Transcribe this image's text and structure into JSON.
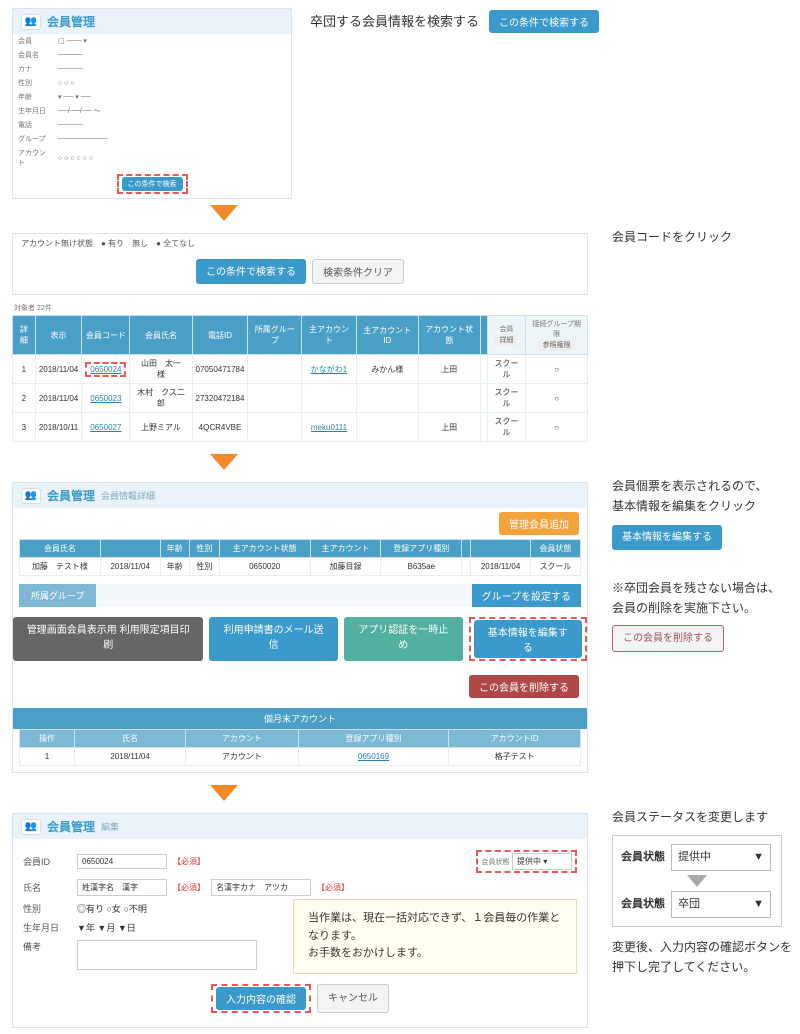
{
  "section1": {
    "caption": "卒団する会員情報を検索する",
    "searchBtn": "この条件で検索する",
    "searchFormTitle": "会員管理"
  },
  "section2": {
    "caption": "会員コードをクリック",
    "radioLabel": "アカウント無け状態",
    "radioAll": "● 有り",
    "radioNone": " 無し",
    "radioEither": "● 全てなし",
    "searchBtn": "この条件で検索する",
    "clearBtn": "検索条件クリア",
    "resultCount": "対象者 22件",
    "cols": [
      "詳細",
      "表示",
      "会員コード",
      "会員氏名",
      "電話ID",
      "所属グループ",
      "主アカウント",
      "主アカウントID",
      "アカウント状態",
      "",
      "会員",
      "接続グループ期限"
    ],
    "rows": [
      {
        "c": [
          "1",
          "2018/11/04",
          "0650024",
          "山田　太一　様",
          "07050471784",
          "",
          "かながわ1",
          "みかん様",
          "上田",
          "",
          "スクール",
          ""
        ]
      },
      {
        "c": [
          "2",
          "2018/11/04",
          "0650023",
          "木村　クス二郎",
          "27320472184",
          "",
          "",
          "",
          "",
          "",
          "スクール",
          ""
        ]
      },
      {
        "c": [
          "3",
          "2018/10/11",
          "0650027",
          "上野ミアル",
          "4QCR4VBE",
          "",
          "meku0111",
          "",
          "上田",
          "",
          "スクール",
          ""
        ]
      }
    ],
    "subBtn1": "詳細",
    "subBtn2": "参照権限"
  },
  "section3": {
    "caption1": "会員個票を表示されるので、",
    "caption2": "基本情報を編集をクリック",
    "editBtn": "基本情報を編集する",
    "note1": "※卒団会員を残さない場合は、",
    "note2": "会員の削除を実施下さい。",
    "deleteBtn": "この会員を削除する",
    "panelTitle": "会員管理",
    "panelSub": "会員情報詳細",
    "orangeBtn": "管理会員追加",
    "detailCols": [
      "会員氏名",
      "年齢",
      "性別",
      "主アカウント状態",
      "主アカウント",
      "登録アプリ種別",
      "",
      "",
      "会員状態"
    ],
    "detailRow": {
      "name": "加藤　テスト様",
      "date1": "2018/11/04",
      "age": "年齢",
      "sex": "性別",
      "code": "0650020",
      "acc": "加藤目録",
      "accId": "B635ae",
      "ver": "",
      "d2": "2018/11/04",
      "st": "スクール"
    },
    "groupLabel": "所属グループ",
    "groupBtn": "グループを設定する",
    "btn1": "管理画面会員表示用 利用限定項目印刷",
    "btn2": "利用申請書のメール送信",
    "btn3": "アプリ認証を一時止め",
    "btn4": "基本情報を編集する",
    "delRight": "この会員を削除する",
    "subHeader": "個月末アカウント",
    "subCols": [
      "操作",
      "氏名",
      "アカウント",
      "登録アプリ種別",
      "アカウントID"
    ],
    "subRow": {
      "a": "1",
      "d": "2018/11/04",
      "acc": "アカウント",
      "code": "0650169",
      "id": "格子テスト"
    }
  },
  "section4": {
    "caption": "会員ステータスを変更します",
    "panelTitle": "会員管理",
    "panelSub": "編集",
    "memberIdLabel": "会員ID",
    "memberId": "0650024",
    "reqTag": "【必須】",
    "statusLabel": "会員状態",
    "statusVal": "提供中",
    "nameLabel": "氏名",
    "nameVal1": "姓漢字名　漢字",
    "nameVal2": "名漢字カナ　アツカ",
    "sexLabel": "性別",
    "sexOptions": "◎有り ○女 ○不明",
    "birthLabel": "生年月日",
    "birthVal": "▼年 ▼月 ▼日",
    "noteLabel": "備考",
    "confirmBtn": "入力内容の確認",
    "cancelBtn": "キャンセル",
    "noteBox1": "当作業は、現在一括対応できず、１会員毎の作業となります。",
    "noteBox2": "お手数をおかけします。",
    "rightLabel": "会員状態",
    "statusBefore": "提供中",
    "statusAfter": "卒団",
    "caption2a": "変更後、入力内容の確認ボタンを",
    "caption2b": "押下し完了してください。"
  }
}
